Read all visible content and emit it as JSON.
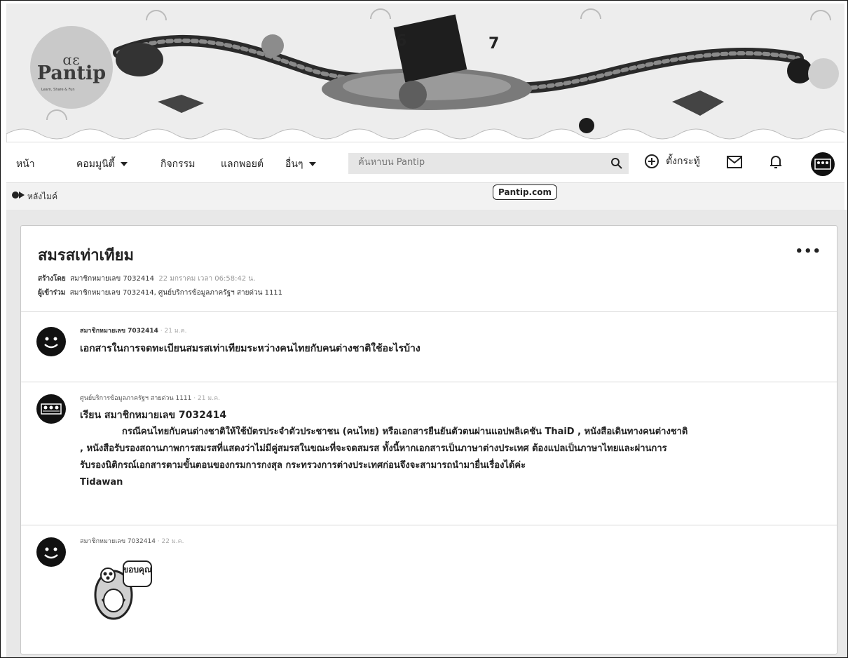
{
  "logo": {
    "mark": "ɑɛ",
    "word": "Pantip",
    "tagline": "Learn, Share & Fun"
  },
  "nav": {
    "home": "หน้า",
    "community": "คอมมูนิตี้",
    "activities": "กิจกรรม",
    "points": "แลกพอยต์",
    "more": "อื่นๆ",
    "search_placeholder": "ค้นหาบน Pantip",
    "create_topic": "ตั้งกระทู้"
  },
  "subbar": {
    "tag": "หลังไมค์",
    "badge": "Pantip.com"
  },
  "topic": {
    "title": "สมรสเท่าเทียม",
    "created_label": "สร้างโดย",
    "created_by": "สมาชิกหมายเลข 7032414",
    "created_time": "22 มกราคม เวลา 06:58:42 น.",
    "participants_label": "ผู้เข้าร่วม",
    "participants": "สมาชิกหมายเลข 7032414, ศูนย์บริการข้อมูลภาครัฐฯ สายด่วน 1111"
  },
  "messages": [
    {
      "author": "สมาชิกหมายเลข 7032414",
      "date": "· 21 ม.ค.",
      "text": "เอกสารในการจดทะเบียนสมรสเท่าเทียมระหว่างคนไทยกับคนต่างชาติใช้อะไรบ้าง"
    },
    {
      "author": "ศูนย์บริการข้อมูลภาครัฐฯ สายด่วน 1111",
      "date": "· 21 ม.ค.",
      "greeting": "เรียน สมาชิกหมายเลข 7032414",
      "line1": "กรณีคนไทยกับคนต่างชาติให้ใช้บัตรประจำตัวประชาชน (คนไทย) หรือเอกสารยืนยันตัวตนผ่านแอปพลิเคชัน ThaiD , หนังสือเดินทางคนต่างชาติ",
      "line2": ", หนังสือรับรองสถานภาพการสมรสที่แสดงว่าไม่มีคู่สมรสในขณะที่จะจดสมรส ทั้งนี้หากเอกสารเป็นภาษาต่างประเทศ ต้องแปลเป็นภาษาไทยและผ่านการ",
      "line3": "รับรองนิติกรณ์เอกสารตามขั้นตอนของกรมการกงสุล กระทรวงการต่างประเทศก่อนจึงจะสามารถนำมายื่นเรื่องได้ค่ะ",
      "signature": "Tidawan"
    },
    {
      "author": "สมาชิกหมายเลข 7032414",
      "date": "· 22 ม.ค.",
      "sticker_text": "ขอบคุณ"
    }
  ],
  "colors": {
    "banner": "#ededed",
    "gray_area": "#e8e8e8",
    "text": "#222222"
  }
}
